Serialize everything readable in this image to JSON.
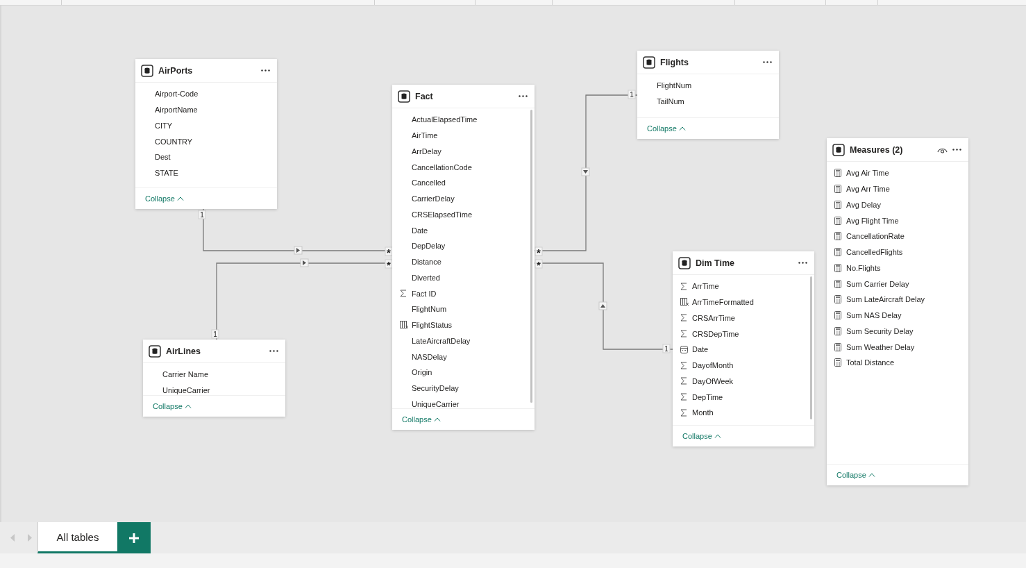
{
  "tables": [
    {
      "title": "AirPorts",
      "scrollbar": false,
      "eye": false,
      "collapse": "Collapse",
      "fields": [
        {
          "name": "Airport-Code",
          "kind": "plain"
        },
        {
          "name": "AirportName",
          "kind": "plain"
        },
        {
          "name": "CITY",
          "kind": "plain"
        },
        {
          "name": "COUNTRY",
          "kind": "plain"
        },
        {
          "name": "Dest",
          "kind": "plain"
        },
        {
          "name": "STATE",
          "kind": "plain"
        }
      ]
    },
    {
      "title": "Fact",
      "scrollbar": true,
      "eye": false,
      "collapse": "Collapse",
      "fields": [
        {
          "name": "ActualElapsedTime",
          "kind": "plain"
        },
        {
          "name": "AirTime",
          "kind": "plain"
        },
        {
          "name": "ArrDelay",
          "kind": "plain"
        },
        {
          "name": "CancellationCode",
          "kind": "plain"
        },
        {
          "name": "Cancelled",
          "kind": "plain"
        },
        {
          "name": "CarrierDelay",
          "kind": "plain"
        },
        {
          "name": "CRSElapsedTime",
          "kind": "plain"
        },
        {
          "name": "Date",
          "kind": "plain"
        },
        {
          "name": "DepDelay",
          "kind": "plain"
        },
        {
          "name": "Distance",
          "kind": "plain"
        },
        {
          "name": "Diverted",
          "kind": "plain"
        },
        {
          "name": "Fact ID",
          "kind": "sum"
        },
        {
          "name": "FlightNum",
          "kind": "plain"
        },
        {
          "name": "FlightStatus",
          "kind": "calc"
        },
        {
          "name": "LateAircraftDelay",
          "kind": "plain"
        },
        {
          "name": "NASDelay",
          "kind": "plain"
        },
        {
          "name": "Origin",
          "kind": "plain"
        },
        {
          "name": "SecurityDelay",
          "kind": "plain"
        },
        {
          "name": "UniqueCarrier",
          "kind": "plain"
        }
      ]
    },
    {
      "title": "Flights",
      "scrollbar": false,
      "eye": false,
      "collapse": "Collapse",
      "fields": [
        {
          "name": "FlightNum",
          "kind": "plain"
        },
        {
          "name": "TailNum",
          "kind": "plain"
        }
      ]
    },
    {
      "title": "Measures (2)",
      "scrollbar": false,
      "eye": true,
      "collapse": "Collapse",
      "fields": [
        {
          "name": "Avg Air Time",
          "kind": "measure"
        },
        {
          "name": "Avg Arr Time",
          "kind": "measure"
        },
        {
          "name": "Avg Delay",
          "kind": "measure"
        },
        {
          "name": "Avg Flight Time",
          "kind": "measure"
        },
        {
          "name": "CancellationRate",
          "kind": "measure"
        },
        {
          "name": "CancelledFlights",
          "kind": "measure"
        },
        {
          "name": "No.Flights",
          "kind": "measure"
        },
        {
          "name": "Sum Carrier Delay",
          "kind": "measure"
        },
        {
          "name": "Sum LateAircraft Delay",
          "kind": "measure"
        },
        {
          "name": "Sum NAS Delay",
          "kind": "measure"
        },
        {
          "name": "Sum Security Delay",
          "kind": "measure"
        },
        {
          "name": "Sum Weather Delay",
          "kind": "measure"
        },
        {
          "name": "Total Distance",
          "kind": "measure"
        }
      ]
    },
    {
      "title": "Dim Time",
      "scrollbar": true,
      "eye": false,
      "collapse": "Collapse",
      "fields": [
        {
          "name": "ArrTime",
          "kind": "sum"
        },
        {
          "name": "ArrTimeFormatted",
          "kind": "calc"
        },
        {
          "name": "CRSArrTime",
          "kind": "sum"
        },
        {
          "name": "CRSDepTime",
          "kind": "sum"
        },
        {
          "name": "Date",
          "kind": "date"
        },
        {
          "name": "DayofMonth",
          "kind": "sum"
        },
        {
          "name": "DayOfWeek",
          "kind": "sum"
        },
        {
          "name": "DepTime",
          "kind": "sum"
        },
        {
          "name": "Month",
          "kind": "sum"
        }
      ]
    },
    {
      "title": "AirLines",
      "scrollbar": false,
      "eye": false,
      "collapse": "Collapse",
      "fields": [
        {
          "name": "Carrier Name",
          "kind": "plain"
        },
        {
          "name": "UniqueCarrier",
          "kind": "plain"
        }
      ]
    }
  ],
  "relationships": [
    {
      "one": "1",
      "many": "*"
    },
    {
      "one": "1",
      "many": "*"
    },
    {
      "one": "1",
      "many": "*"
    },
    {
      "one": "1",
      "many": "*"
    }
  ],
  "page_tabs": [
    {
      "label": "All tables",
      "selected": true
    }
  ]
}
